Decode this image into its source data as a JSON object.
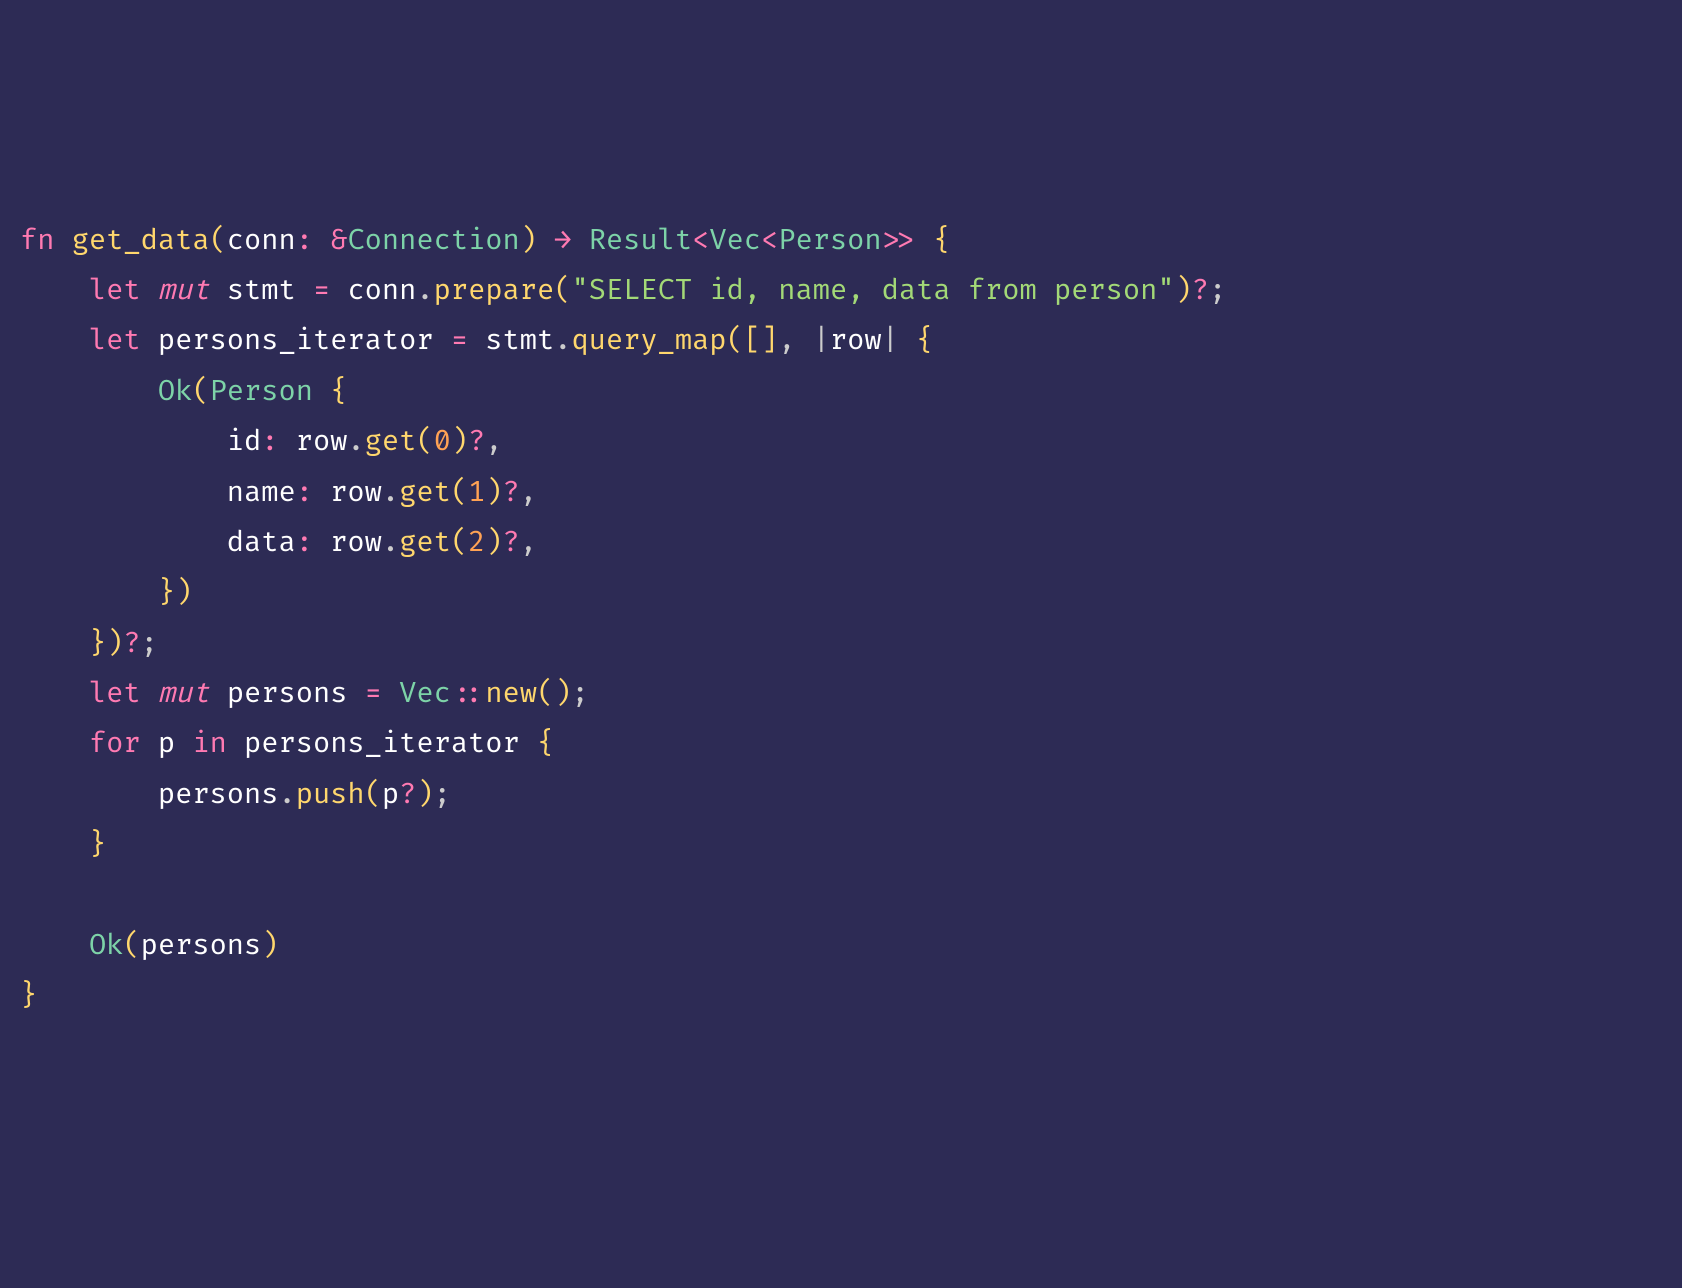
{
  "code": {
    "line1": {
      "fn": "fn",
      "fn_name": "get_data",
      "lparen": "(",
      "param": "conn",
      "colon": ":",
      "amp": "&",
      "type": "Connection",
      "rparen": ")",
      "arrow": "→",
      "result": "Result",
      "langle": "<",
      "vec": "Vec",
      "langle2": "<",
      "person": "Person",
      "rangle": ">>",
      "lbrace": "{"
    },
    "line2": {
      "let": "let",
      "mut": "mut",
      "var": "stmt",
      "eq": "=",
      "conn": "conn",
      "dot": ".",
      "prepare": "prepare",
      "lparen": "(",
      "sql": "\"SELECT id, name, data from person\"",
      "rparen": ")",
      "q": "?",
      "semi": ";"
    },
    "line3": {
      "let": "let",
      "var": "persons_iterator",
      "eq": "=",
      "stmt": "stmt",
      "dot": ".",
      "query_map": "query_map",
      "lparen": "(",
      "lbracket": "[",
      "rbracket": "]",
      "comma": ",",
      "pipe1": "|",
      "row": "row",
      "pipe2": "|",
      "lbrace": "{"
    },
    "line4": {
      "ok": "Ok",
      "lparen": "(",
      "person": "Person",
      "lbrace": "{"
    },
    "line5": {
      "field": "id",
      "colon": ":",
      "row": "row",
      "dot": ".",
      "get": "get",
      "lparen": "(",
      "num": "0",
      "rparen": ")",
      "q": "?",
      "comma": ","
    },
    "line6": {
      "field": "name",
      "colon": ":",
      "row": "row",
      "dot": ".",
      "get": "get",
      "lparen": "(",
      "num": "1",
      "rparen": ")",
      "q": "?",
      "comma": ","
    },
    "line7": {
      "field": "data",
      "colon": ":",
      "row": "row",
      "dot": ".",
      "get": "get",
      "lparen": "(",
      "num": "2",
      "rparen": ")",
      "q": "?",
      "comma": ","
    },
    "line8": {
      "rbrace": "}",
      "rparen": ")"
    },
    "line9": {
      "rbrace": "}",
      "rparen": ")",
      "q": "?",
      "semi": ";"
    },
    "line10": {
      "let": "let",
      "mut": "mut",
      "var": "persons",
      "eq": "=",
      "vec": "Vec",
      "dcolon": "::",
      "new": "new",
      "lparen": "(",
      "rparen": ")",
      "semi": ";"
    },
    "line11": {
      "for": "for",
      "p": "p",
      "in": "in",
      "iter": "persons_iterator",
      "lbrace": "{"
    },
    "line12": {
      "persons": "persons",
      "dot": ".",
      "push": "push",
      "lparen": "(",
      "p": "p",
      "q": "?",
      "rparen": ")",
      "semi": ";"
    },
    "line13": {
      "rbrace": "}"
    },
    "line15": {
      "ok": "Ok",
      "lparen": "(",
      "persons": "persons",
      "rparen": ")"
    },
    "line16": {
      "rbrace": "}"
    }
  }
}
